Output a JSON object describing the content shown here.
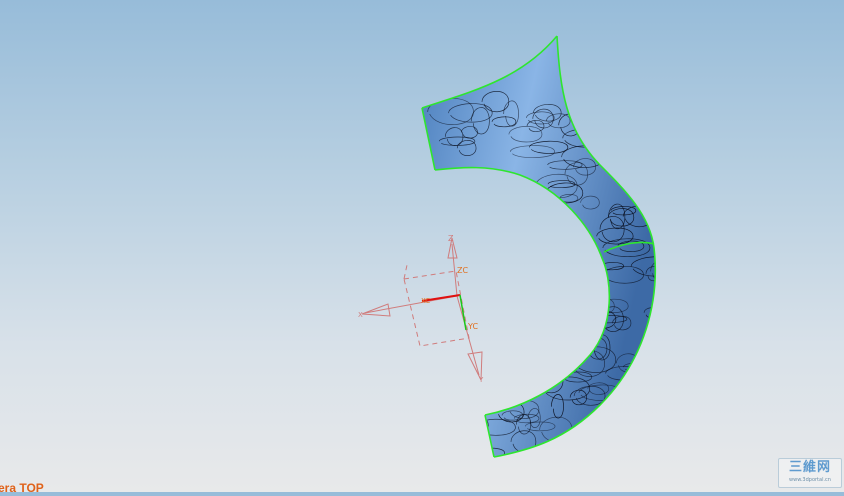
{
  "viewport": {
    "view_label": "era TOP",
    "background_top": "#97bcd9",
    "background_bottom": "#e8e9ea"
  },
  "model": {
    "surface_color": "#6f9fd6",
    "edge_color": "#2ee62e",
    "contour_color": "#0a1020"
  },
  "triad": {
    "work_color": "#d07c7c",
    "x_label": "X",
    "y_label": "Y",
    "z_label": "Z",
    "xc_label": "XC",
    "yc_label": "YC",
    "zc_label": "ZC",
    "xc_color": "#e01010",
    "yc_color": "#19c819",
    "label_color": "#e07020"
  },
  "watermark": {
    "title": "三維网",
    "url": "www.3dportal.cn"
  }
}
